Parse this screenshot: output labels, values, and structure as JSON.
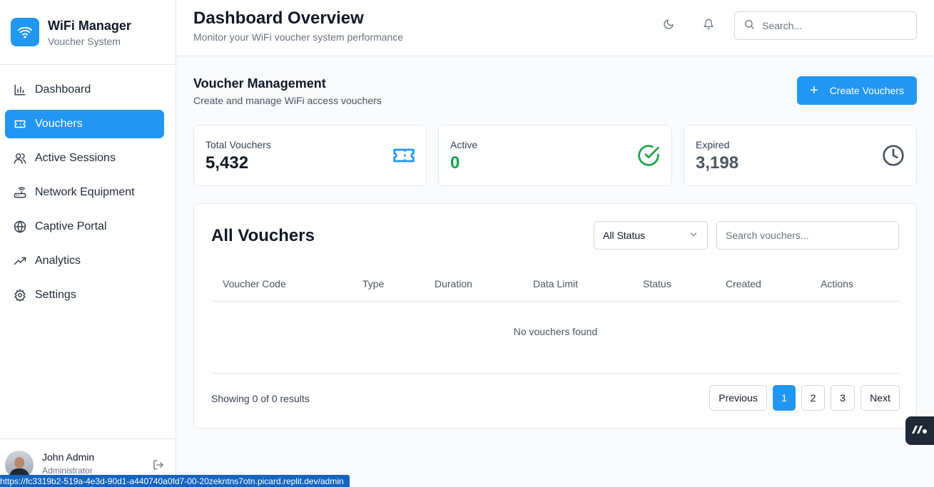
{
  "brand": {
    "title": "WiFi Manager",
    "subtitle": "Voucher System",
    "icon": "wifi-icon"
  },
  "sidebar": {
    "items": [
      {
        "label": "Dashboard",
        "icon": "bar-chart-icon",
        "active": false
      },
      {
        "label": "Vouchers",
        "icon": "ticket-icon",
        "active": true
      },
      {
        "label": "Active Sessions",
        "icon": "users-icon",
        "active": false
      },
      {
        "label": "Network Equipment",
        "icon": "router-icon",
        "active": false
      },
      {
        "label": "Captive Portal",
        "icon": "globe-icon",
        "active": false
      },
      {
        "label": "Analytics",
        "icon": "trending-up-icon",
        "active": false
      },
      {
        "label": "Settings",
        "icon": "gear-icon",
        "active": false
      }
    ]
  },
  "user": {
    "name": "John Admin",
    "role": "Administrator"
  },
  "status_url": "https://fc3319b2-519a-4e3d-90d1-a440740a0fd7-00-20zekntns7otn.picard.replit.dev/admin",
  "header": {
    "title": "Dashboard Overview",
    "subtitle": "Monitor your WiFi voucher system performance",
    "search_placeholder": "Search..."
  },
  "section": {
    "title": "Voucher Management",
    "subtitle": "Create and manage WiFi access vouchers",
    "create_label": "Create Vouchers"
  },
  "stats": [
    {
      "label": "Total Vouchers",
      "value": "5,432",
      "color": "#111827",
      "icon": "ticket-icon"
    },
    {
      "label": "Active",
      "value": "0",
      "color": "#16a34a",
      "icon": "check-circle-icon"
    },
    {
      "label": "Expired",
      "value": "3,198",
      "color": "#4b5563",
      "icon": "clock-icon"
    }
  ],
  "vouchers": {
    "title": "All Vouchers",
    "status_filter": "All Status",
    "search_placeholder": "Search vouchers...",
    "columns": [
      "Voucher Code",
      "Type",
      "Duration",
      "Data Limit",
      "Status",
      "Created",
      "Actions"
    ],
    "empty_text": "No vouchers found",
    "showing": "Showing 0 of 0 results",
    "pagination": {
      "previous": "Previous",
      "pages": [
        "1",
        "2",
        "3"
      ],
      "current": "1",
      "next": "Next"
    }
  },
  "colors": {
    "accent": "#2196f3",
    "success": "#16a34a"
  }
}
